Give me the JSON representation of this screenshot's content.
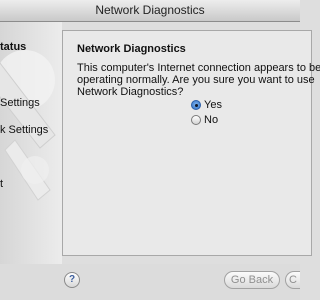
{
  "window": {
    "title": "Network Diagnostics"
  },
  "sidebar": {
    "items": [
      {
        "label": "tatus",
        "bold": true
      },
      {
        "label": "Settings",
        "bold": false
      },
      {
        "label": "k Settings",
        "bold": false
      },
      {
        "label": "t",
        "bold": false
      }
    ]
  },
  "panel": {
    "heading": "Network Diagnostics",
    "message": "This computer's Internet connection appears to be operating normally. Are you sure you want to use Network Diagnostics?",
    "options": [
      {
        "label": "Yes",
        "selected": true
      },
      {
        "label": "No",
        "selected": false
      }
    ]
  },
  "footer": {
    "help_label": "?",
    "back_label": "Go Back",
    "continue_label": "C"
  },
  "colors": {
    "selected_radio": "#2f6fc4",
    "disabled_text": "#8f8f8f"
  }
}
